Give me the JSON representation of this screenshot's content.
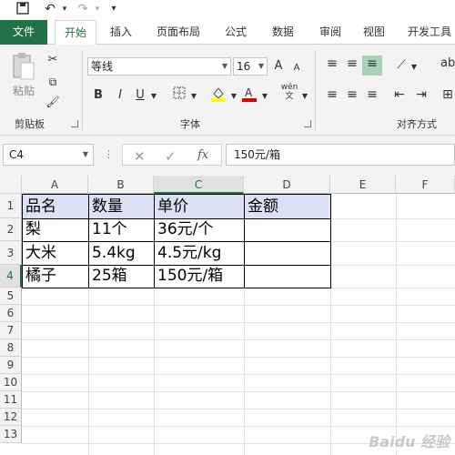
{
  "ribbon_tabs": [
    "文件",
    "开始",
    "插入",
    "页面布局",
    "公式",
    "数据",
    "审阅",
    "视图",
    "开发工具"
  ],
  "clipboard": {
    "paste_label": "粘贴",
    "group_label": "剪贴板"
  },
  "font": {
    "name": "等线",
    "size": "16",
    "group_label": "字体",
    "bold": "B",
    "italic": "I",
    "underline": "U",
    "grow": "A",
    "shrink": "A",
    "phonetic": "wén"
  },
  "alignment": {
    "group_label": "对齐方式"
  },
  "formula_bar": {
    "name_box": "C4",
    "fx": "fx",
    "value": "150元/箱"
  },
  "columns": [
    "A",
    "B",
    "C",
    "D",
    "E",
    "F"
  ],
  "rows": [
    "1",
    "2",
    "3",
    "4",
    "5",
    "6",
    "7",
    "8",
    "9",
    "10",
    "11",
    "12",
    "13"
  ],
  "table": {
    "header": [
      "品名",
      "数量",
      "单价",
      "金额"
    ],
    "rows": [
      [
        "梨",
        "11个",
        "36元/个",
        ""
      ],
      [
        "大米",
        "5.4kg",
        "4.5元/kg",
        ""
      ],
      [
        "橘子",
        "25箱",
        "150元/箱",
        ""
      ]
    ]
  },
  "watermark": "Baidu 经验",
  "colors": {
    "accent": "#217346",
    "header_fill": "#dce1f5"
  }
}
